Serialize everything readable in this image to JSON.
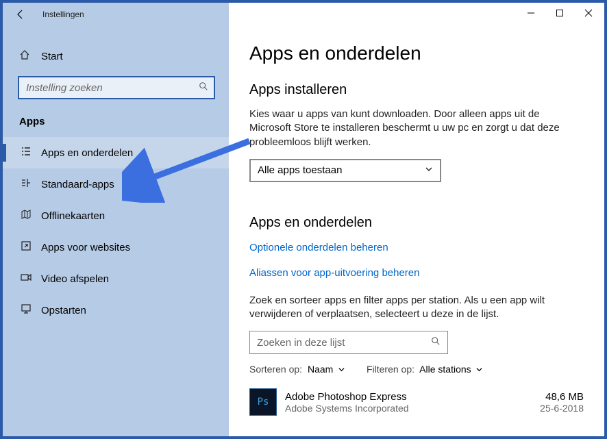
{
  "titlebar": {
    "title": "Instellingen"
  },
  "home": {
    "label": "Start"
  },
  "search": {
    "placeholder": "Instelling zoeken"
  },
  "section": "Apps",
  "nav": [
    {
      "label": "Apps en onderdelen",
      "sel": true
    },
    {
      "label": "Standaard-apps"
    },
    {
      "label": "Offlinekaarten"
    },
    {
      "label": "Apps voor websites"
    },
    {
      "label": "Video afspelen"
    },
    {
      "label": "Opstarten"
    }
  ],
  "page": {
    "title": "Apps en onderdelen",
    "install": {
      "heading": "Apps installeren",
      "desc": "Kies waar u apps van kunt downloaden. Door alleen apps uit de Microsoft Store te installeren beschermt u uw pc en zorgt u dat deze probleemloos blijft werken.",
      "select": "Alle apps toestaan"
    },
    "features": {
      "heading": "Apps en onderdelen",
      "link1": "Optionele onderdelen beheren",
      "link2": "Aliassen voor app-uitvoering beheren",
      "desc": "Zoek en sorteer apps en filter apps per station. Als u een app wilt verwijderen of verplaatsen, selecteert u deze in de lijst.",
      "filter_placeholder": "Zoeken in deze lijst",
      "sort_label": "Sorteren op:",
      "sort_value": "Naam",
      "filter_label": "Filteren op:",
      "filter_value": "Alle stations"
    },
    "apps": [
      {
        "name": "Adobe Photoshop Express",
        "publisher": "Adobe Systems Incorporated",
        "size": "48,6 MB",
        "date": "25-6-2018",
        "iconLabel": "Ps"
      }
    ]
  }
}
